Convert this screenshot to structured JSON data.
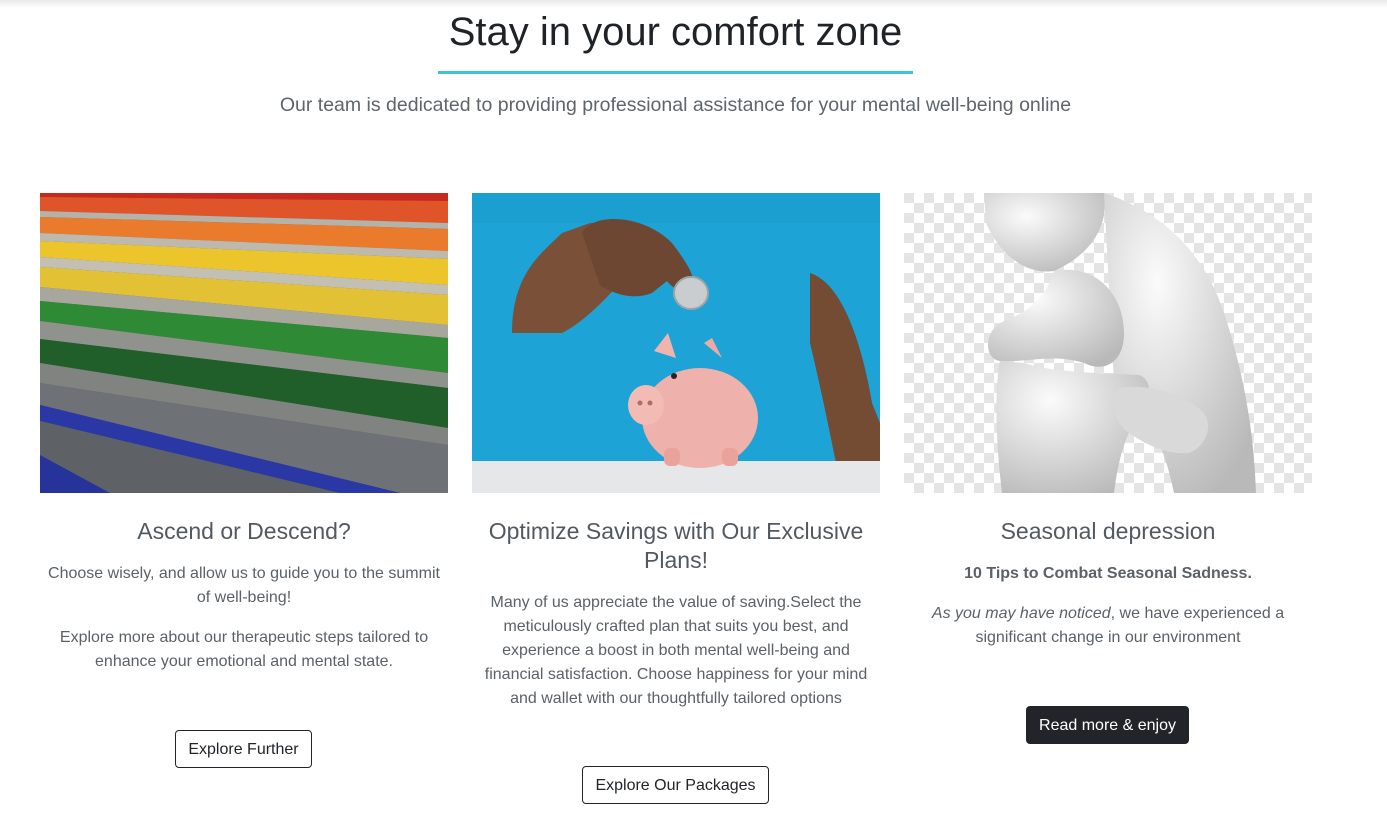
{
  "hero": {
    "title": "Stay in your comfort zone",
    "subtitle": "Our team is dedicated to providing professional assistance for your mental well-being online",
    "accent_color": "#3ec3d3"
  },
  "cards": [
    {
      "image": "rainbow-stairs-photo",
      "title": "Ascend or Descend?",
      "paragraphs": [
        "Choose wisely, and allow us to guide you to the summit of well-being!",
        "Explore more about our therapeutic steps tailored to enhance your emotional and mental state."
      ],
      "button_label": "Explore Further"
    },
    {
      "image": "piggy-bank-coin-photo",
      "title": "Optimize Savings with Our Exclusive Plans!",
      "paragraphs": [
        "Many of us appreciate the value of saving.Select the meticulously crafted plan that suits you best, and experience a boost in both mental well-being and financial satisfaction. Choose happiness for your mind and wallet with our thoughtfully tailored options"
      ],
      "button_label": "Explore Our Packages"
    },
    {
      "image": "sad-3d-figure-photo",
      "title": "Seasonal depression",
      "subtitle": "10 Tips to Combat Seasonal Sadness.",
      "intro_italic": "As you may have noticed",
      "intro_rest": ", we have experienced a significant change in our environment",
      "button_label": "Read more & enjoy"
    }
  ]
}
